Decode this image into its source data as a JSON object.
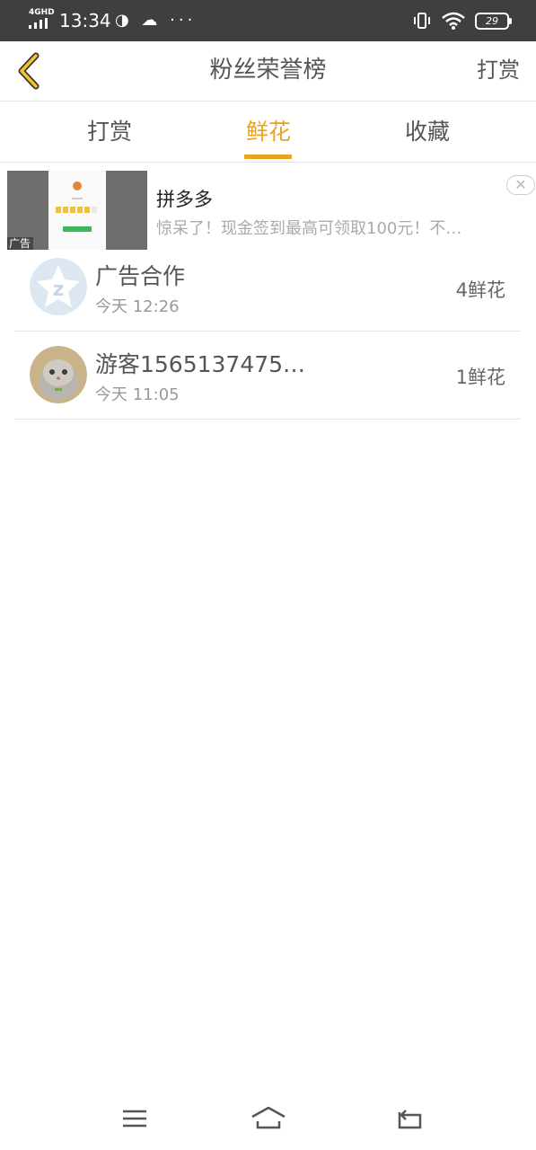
{
  "status_bar": {
    "network": "4GHD",
    "time": "13:34",
    "left_icons": "◑ ☁ ···",
    "battery": "29"
  },
  "header": {
    "title": "粉丝荣誉榜",
    "right_action": "打赏",
    "back_icon": "chevron-left-icon",
    "accent_color": "#e8a321"
  },
  "tabs": [
    {
      "label": "打赏",
      "active": false
    },
    {
      "label": "鲜花",
      "active": true
    },
    {
      "label": "收藏",
      "active": false
    }
  ],
  "ad": {
    "badge": "广告",
    "title": "拼多多",
    "description": "惊呆了！现金签到最高可领取100元！不…",
    "close": "✕"
  },
  "list": [
    {
      "name": "广告合作",
      "time": "今天 12:26",
      "amount": "4鲜花",
      "avatar": "qzone-star-avatar"
    },
    {
      "name": "游客1565137475…",
      "time": "今天 11:05",
      "amount": "1鲜花",
      "avatar": "cat-photo-avatar"
    }
  ],
  "nav": [
    "menu-icon",
    "home-icon",
    "back-icon"
  ]
}
